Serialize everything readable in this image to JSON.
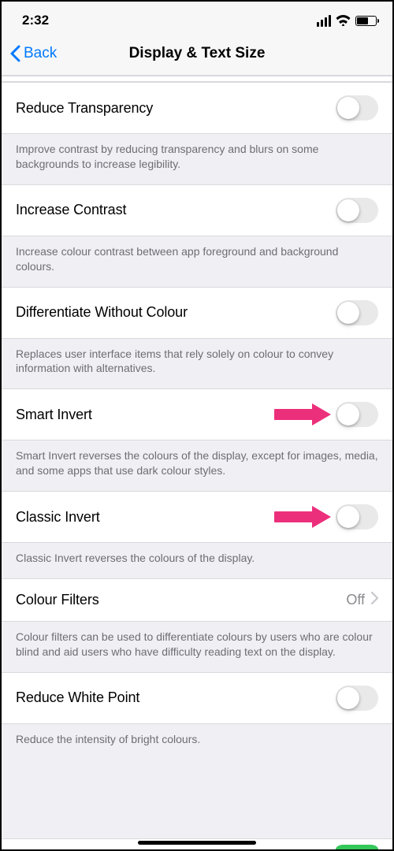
{
  "status": {
    "time": "2:32"
  },
  "nav": {
    "back": "Back",
    "title": "Display & Text Size"
  },
  "rows": {
    "reduce_transparency": {
      "label": "Reduce Transparency",
      "footer": "Improve contrast by reducing transparency and blurs on some backgrounds to increase legibility."
    },
    "increase_contrast": {
      "label": "Increase Contrast",
      "footer": "Increase colour contrast between app foreground and background colours."
    },
    "differentiate": {
      "label": "Differentiate Without Colour",
      "footer": "Replaces user interface items that rely solely on colour to convey information with alternatives."
    },
    "smart_invert": {
      "label": "Smart Invert",
      "footer": "Smart Invert reverses the colours of the display, except for images, media, and some apps that use dark colour styles."
    },
    "classic_invert": {
      "label": "Classic Invert",
      "footer": "Classic Invert reverses the colours of the display."
    },
    "colour_filters": {
      "label": "Colour Filters",
      "value": "Off",
      "footer": "Colour filters can be used to differentiate colours by users who are colour blind and aid users who have difficulty reading text on the display."
    },
    "reduce_white_point": {
      "label": "Reduce White Point",
      "footer": "Reduce the intensity of bright colours."
    }
  }
}
